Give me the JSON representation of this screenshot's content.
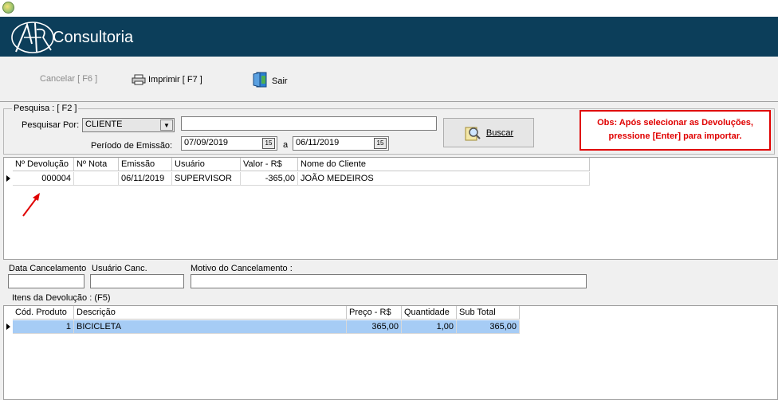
{
  "header": {
    "brand": "Consultoria"
  },
  "toolbar": {
    "cancel": "Cancelar [ F6 ]",
    "print": "Imprimir  [ F7 ]",
    "exit": "Sair"
  },
  "search": {
    "legend": "Pesquisa : [ F2 ]",
    "search_by_label": "Pesquisar Por:",
    "search_by_value": "CLIENTE",
    "search_text": "",
    "period_label": "Período de Emissão:",
    "date_from": "07/09/2019",
    "date_sep": "a",
    "date_to": "06/11/2019",
    "search_button": "Buscar"
  },
  "note": {
    "line1": "Obs: Após selecionar as Devoluções,",
    "line2": "pressione [Enter] para importar."
  },
  "returns_grid": {
    "columns": [
      "Nº Devolução",
      "Nº Nota",
      "Emissão",
      "Usuário",
      "Valor - R$",
      "Nome do Cliente"
    ],
    "rows": [
      {
        "numero": "000004",
        "nota": "",
        "emissao": "06/11/2019",
        "usuario": "SUPERVISOR",
        "valor": "-365,00",
        "cliente": "JOÃO MEDEIROS"
      }
    ]
  },
  "cancel_info": {
    "date_label": "Data Cancelamento",
    "user_label": "Usuário Canc.",
    "reason_label": "Motivo do Cancelamento  :",
    "date_value": "",
    "user_value": "",
    "reason_value": ""
  },
  "items": {
    "legend": "Itens da Devolução : (F5)",
    "columns": [
      "Cód. Produto",
      "Descrição",
      "Preço - R$",
      "Quantidade",
      "Sub Total"
    ],
    "rows": [
      {
        "codigo": "1",
        "descricao": "BICICLETA",
        "preco": "365,00",
        "quantidade": "1,00",
        "subtotal": "365,00"
      }
    ]
  },
  "colors": {
    "header_bg": "#0c3e5a",
    "note_red": "#e00000",
    "selected_row": "#a6ccf5"
  },
  "icons": [
    "app-icon",
    "logo-icon",
    "printer-icon",
    "exit-door-icon",
    "search-magnifier-icon",
    "calendar-icon",
    "dropdown-arrow-icon",
    "row-indicator-icon",
    "red-arrow-icon"
  ]
}
